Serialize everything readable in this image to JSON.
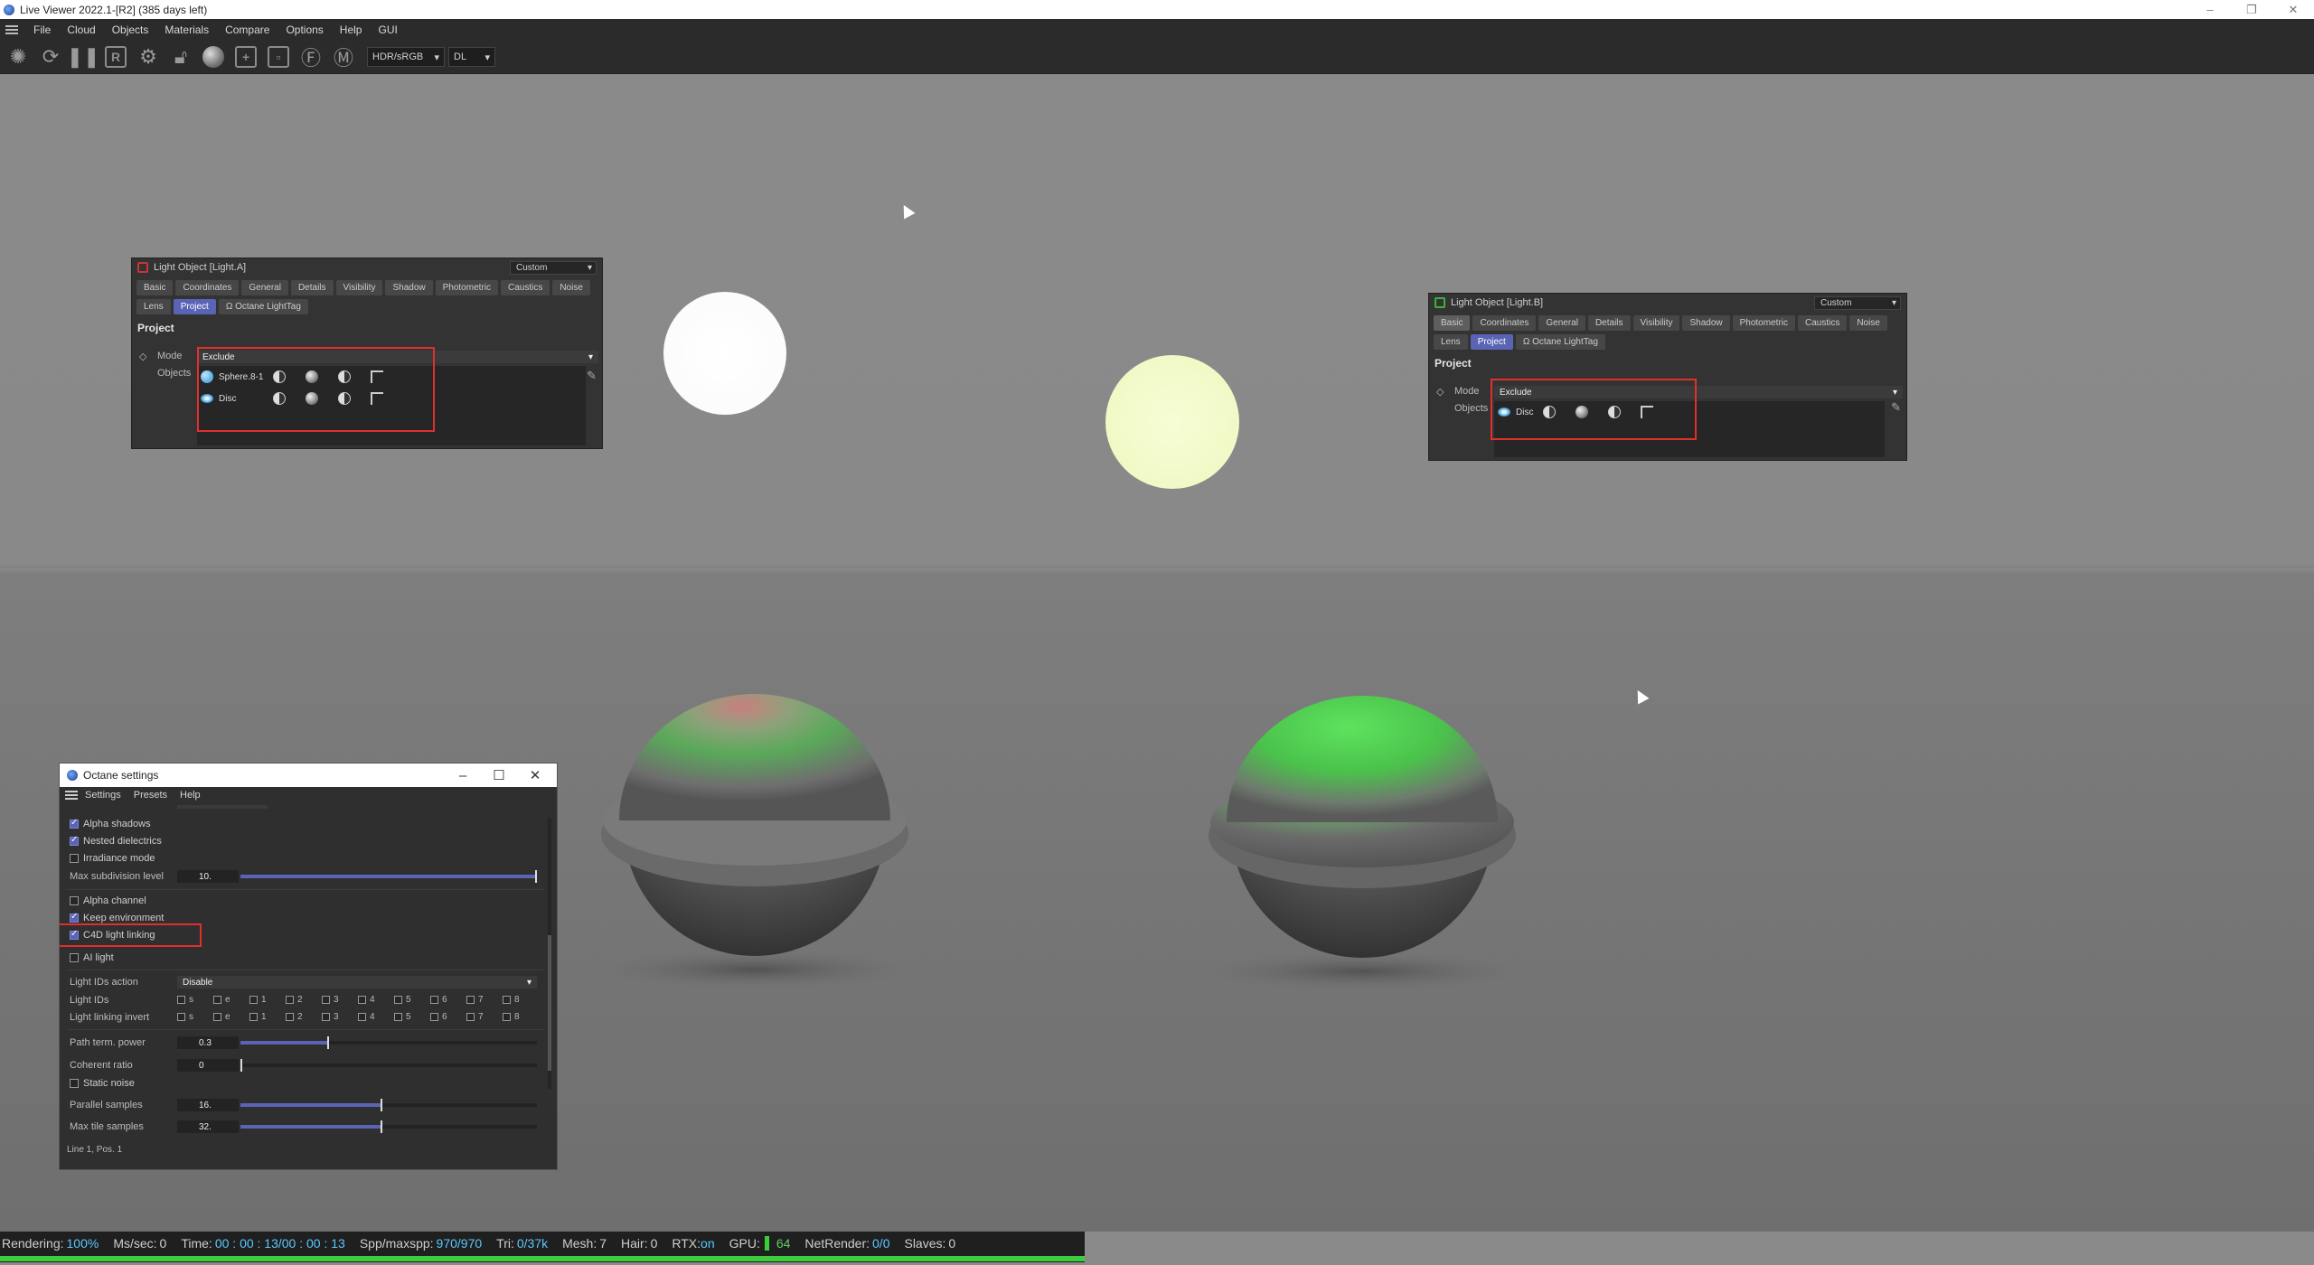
{
  "window": {
    "title": "Live Viewer 2022.1-[R2] (385 days left)"
  },
  "menubar": {
    "items": [
      "File",
      "Cloud",
      "Objects",
      "Materials",
      "Compare",
      "Options",
      "Help",
      "GUI"
    ]
  },
  "toolbar": {
    "buttons": [
      "aperture-icon",
      "refresh-icon",
      "pause-icon",
      "region-render-icon",
      "settings-gear-icon",
      "lock-icon",
      "material-ball-icon",
      "add-icon",
      "add-object-icon",
      "focus-pick-icon",
      "material-pick-icon"
    ],
    "region_label": "R",
    "colorspace": "HDR/sRGB",
    "mode": "DL"
  },
  "light_a": {
    "title": "Light Object [Light.A]",
    "preset": "Custom",
    "tabs_row1": [
      "Basic",
      "Coordinates",
      "General",
      "Details",
      "Visibility",
      "Shadow",
      "Photometric",
      "Caustics"
    ],
    "tabs_row2": [
      "Noise",
      "Lens",
      "Project",
      "Ω Octane LightTag"
    ],
    "active_tab": "Project",
    "section": "Project",
    "mode_label": "Mode",
    "mode_value": "Exclude",
    "objects_label": "Objects",
    "objects": [
      "Sphere.8-1",
      "Disc"
    ]
  },
  "light_b": {
    "title": "Light Object [Light.B]",
    "preset": "Custom",
    "tabs_row1": [
      "Basic",
      "Coordinates",
      "General",
      "Details",
      "Visibility",
      "Shadow",
      "Photometric",
      "Caustics"
    ],
    "tabs_row2": [
      "Noise",
      "Lens",
      "Project",
      "Ω Octane LightTag"
    ],
    "active_tab": "Project",
    "section": "Project",
    "mode_label": "Mode",
    "mode_value": "Exclude",
    "objects_label": "Objects",
    "objects": [
      "Disc"
    ]
  },
  "octane": {
    "title": "Octane settings",
    "menu": [
      "Settings",
      "Presets",
      "Help"
    ],
    "alpha_shadows": {
      "label": "Alpha shadows",
      "checked": true
    },
    "nested_dielectrics": {
      "label": "Nested dielectrics",
      "checked": true
    },
    "irradiance_mode": {
      "label": "Irradiance mode",
      "checked": false
    },
    "max_subdivision": {
      "label": "Max subdivision level",
      "value": "10.",
      "fraction": 1.0
    },
    "alpha_channel": {
      "label": "Alpha channel",
      "checked": false
    },
    "keep_environment": {
      "label": "Keep environment",
      "checked": true
    },
    "c4d_light_linking": {
      "label": "C4D light linking",
      "checked": true
    },
    "ai_light": {
      "label": "AI light",
      "checked": false
    },
    "light_ids_action": {
      "label": "Light IDs action",
      "value": "Disable"
    },
    "light_ids": {
      "label": "Light IDs",
      "ids": [
        "s",
        "e",
        "1",
        "2",
        "3",
        "4",
        "5",
        "6",
        "7",
        "8"
      ]
    },
    "light_linking_invert": {
      "label": "Light linking invert",
      "ids": [
        "s",
        "e",
        "1",
        "2",
        "3",
        "4",
        "5",
        "6",
        "7",
        "8"
      ]
    },
    "path_term_power": {
      "label": "Path term. power",
      "value": "0.3",
      "fraction": 0.3
    },
    "coherent_ratio": {
      "label": "Coherent ratio",
      "value": "0",
      "fraction": 0.0
    },
    "static_noise": {
      "label": "Static noise",
      "checked": false
    },
    "parallel_samples": {
      "label": "Parallel samples",
      "value": "16.",
      "fraction": 0.48
    },
    "max_tile_samples": {
      "label": "Max tile samples",
      "value": "32.",
      "fraction": 0.48
    },
    "status": "Line 1, Pos. 1"
  },
  "statusbar": {
    "rendering_label": "Rendering:",
    "rendering_value": "100%",
    "ms_label": "Ms/sec:",
    "ms_value": "0",
    "time_label": "Time:",
    "time_value": "00 : 00 : 13/00 : 00 : 13",
    "spp_label": "Spp/maxspp:",
    "spp_value": "970/970",
    "tri_label": "Tri:",
    "tri_value": "0/37k",
    "mesh_label": "Mesh:",
    "mesh_value": "7",
    "hair_label": "Hair:",
    "hair_value": "0",
    "rtx_label": "RTX:",
    "rtx_value": "on",
    "gpu_label": "GPU:",
    "gpu_value": "64",
    "netrender_label": "NetRender:",
    "netrender_value": "0/0",
    "slaves_label": "Slaves:",
    "slaves_value": "0",
    "progress": 1.0
  },
  "colors": {
    "accent": "#5a64b4",
    "highlight_box": "#e0302c",
    "progress": "#3ccc3c",
    "light_a": "#fdfdfd",
    "light_b": "#f3fbc8"
  }
}
